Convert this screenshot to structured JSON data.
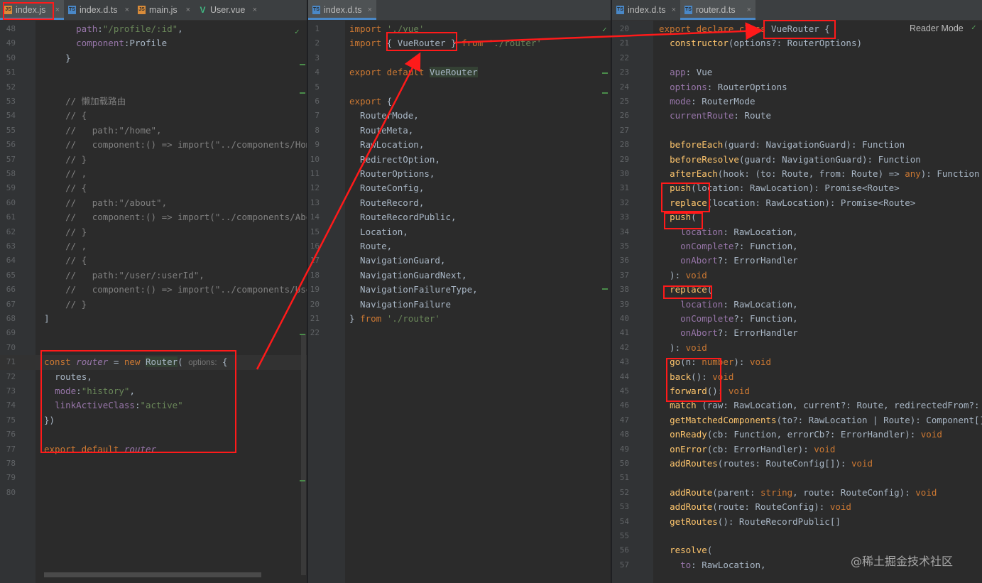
{
  "pane1": {
    "tabs": [
      {
        "label": "index.js",
        "icon": "js-file-icon",
        "active": true
      },
      {
        "label": "index.d.ts",
        "icon": "ts-file-icon",
        "active": false
      },
      {
        "label": "main.js",
        "icon": "js-file-icon",
        "active": false
      },
      {
        "label": "User.vue",
        "icon": "vue-file-icon",
        "active": false
      }
    ],
    "lines": [
      {
        "n": "48",
        "html": "      <span class='prop'>path</span>:<span class='str'>\"/profile/:id\"</span>,"
      },
      {
        "n": "49",
        "html": "      <span class='prop'>component</span>:Profile"
      },
      {
        "n": "50",
        "html": "    }"
      },
      {
        "n": "51",
        "html": ""
      },
      {
        "n": "52",
        "html": ""
      },
      {
        "n": "53",
        "html": "    <span class='com'>// 懒加载路由</span>"
      },
      {
        "n": "54",
        "html": "    <span class='com'>// {</span>"
      },
      {
        "n": "55",
        "html": "    <span class='com'>//   path:\"/home\",</span>"
      },
      {
        "n": "56",
        "html": "    <span class='com'>//   component:() =&gt; import(\"../components/Home\"</span>"
      },
      {
        "n": "57",
        "html": "    <span class='com'>// }</span>"
      },
      {
        "n": "58",
        "html": "    <span class='com'>// ,</span>"
      },
      {
        "n": "59",
        "html": "    <span class='com'>// {</span>"
      },
      {
        "n": "60",
        "html": "    <span class='com'>//   path:\"/about\",</span>"
      },
      {
        "n": "61",
        "html": "    <span class='com'>//   component:() =&gt; import(\"../components/About</span>"
      },
      {
        "n": "62",
        "html": "    <span class='com'>// }</span>"
      },
      {
        "n": "63",
        "html": "    <span class='com'>// ,</span>"
      },
      {
        "n": "64",
        "html": "    <span class='com'>// {</span>"
      },
      {
        "n": "65",
        "html": "    <span class='com'>//   path:\"/user/:userId\",</span>"
      },
      {
        "n": "66",
        "html": "    <span class='com'>//   component:() =&gt; import(\"../components/User\"</span>"
      },
      {
        "n": "67",
        "html": "    <span class='com'>// }</span>"
      },
      {
        "n": "68",
        "html": "]"
      },
      {
        "n": "69",
        "html": ""
      },
      {
        "n": "70",
        "html": ""
      },
      {
        "n": "71",
        "html": "<span class='kw'>const</span> <span class='ital'>router</span> = <span class='kw'>new</span> <span class='fn' style='color:#a9b7c6;background:#344134'>Router</span>( <span class='hint'>options:</span> {"
      },
      {
        "n": "72",
        "html": "  <span class='prop' style='color:#a9b7c6'>routes</span>,"
      },
      {
        "n": "73",
        "html": "  <span class='prop'>mode</span>:<span class='str'>\"history\"</span>,"
      },
      {
        "n": "74",
        "html": "  <span class='prop'>linkActiveClass</span>:<span class='str'>\"active\"</span>"
      },
      {
        "n": "75",
        "html": "})"
      },
      {
        "n": "76",
        "html": ""
      },
      {
        "n": "77",
        "html": "<span class='kw'>export default</span> <span class='ital'>router</span>"
      },
      {
        "n": "78",
        "html": ""
      },
      {
        "n": "79",
        "html": ""
      },
      {
        "n": "80",
        "html": ""
      }
    ]
  },
  "pane2": {
    "tabs": [
      {
        "label": "index.d.ts",
        "icon": "ts-file-icon",
        "active": true
      }
    ],
    "lines": [
      {
        "n": "1",
        "html": "<span class='kw'>import</span> <span class='str'>'./vue'</span>"
      },
      {
        "n": "2",
        "html": "<span class='kw'>import</span> { VueRouter } <span class='kw'>from</span> <span class='str'>'./router'</span>"
      },
      {
        "n": "3",
        "html": ""
      },
      {
        "n": "4",
        "html": "<span class='kw'>export default</span> <span style='background:#344134'>VueRouter</span>"
      },
      {
        "n": "5",
        "html": ""
      },
      {
        "n": "6",
        "html": "<span class='kw'>export</span> {"
      },
      {
        "n": "7",
        "html": "  RouterMode,"
      },
      {
        "n": "8",
        "html": "  RouteMeta,"
      },
      {
        "n": "9",
        "html": "  RawLocation,"
      },
      {
        "n": "10",
        "html": "  RedirectOption,"
      },
      {
        "n": "11",
        "html": "  RouterOptions,"
      },
      {
        "n": "12",
        "html": "  RouteConfig,"
      },
      {
        "n": "13",
        "html": "  RouteRecord,"
      },
      {
        "n": "14",
        "html": "  RouteRecordPublic,"
      },
      {
        "n": "15",
        "html": "  Location,"
      },
      {
        "n": "16",
        "html": "  Route,"
      },
      {
        "n": "17",
        "html": "  NavigationGuard,"
      },
      {
        "n": "18",
        "html": "  NavigationGuardNext,"
      },
      {
        "n": "19",
        "html": "  NavigationFailureType,"
      },
      {
        "n": "20",
        "html": "  NavigationFailure"
      },
      {
        "n": "21",
        "html": "} <span class='kw'>from</span> <span class='str'>'./router'</span>"
      },
      {
        "n": "22",
        "html": ""
      }
    ]
  },
  "pane3": {
    "tabs": [
      {
        "label": "index.d.ts",
        "icon": "ts-file-icon",
        "active": false
      },
      {
        "label": "router.d.ts",
        "icon": "ts-file-icon",
        "active": true
      }
    ],
    "reader_mode": "Reader Mode",
    "lines": [
      {
        "n": "20",
        "html": "<span class='kw'>export declare class</span> VueRouter {"
      },
      {
        "n": "21",
        "html": "  <span class='fn'>constructor</span>(options?: RouterOptions)"
      },
      {
        "n": "22",
        "html": ""
      },
      {
        "n": "23",
        "html": "  <span class='prop'>app</span>: Vue"
      },
      {
        "n": "24",
        "html": "  <span class='prop'>options</span>: RouterOptions"
      },
      {
        "n": "25",
        "html": "  <span class='prop'>mode</span>: RouterMode"
      },
      {
        "n": "26",
        "html": "  <span class='prop'>currentRoute</span>: Route"
      },
      {
        "n": "27",
        "html": ""
      },
      {
        "n": "28",
        "html": "  <span class='fn'>beforeEach</span>(guard: NavigationGuard): Function"
      },
      {
        "n": "29",
        "html": "  <span class='fn'>beforeResolve</span>(guard: NavigationGuard): Function"
      },
      {
        "n": "30",
        "html": "  <span class='fn'>afterEach</span>(hook: (to: Route, from: Route) =&gt; <span class='kw'>any</span>): Function"
      },
      {
        "n": "31",
        "html": "  <span class='fn'>push</span>(location: RawLocation): Promise&lt;Route&gt;"
      },
      {
        "n": "32",
        "html": "  <span class='fn'>replace</span>(location: RawLocation): Promise&lt;Route&gt;"
      },
      {
        "n": "33",
        "html": "  <span class='fn'>push</span>("
      },
      {
        "n": "34",
        "html": "    <span class='prop'>location</span>: RawLocation,"
      },
      {
        "n": "35",
        "html": "    <span class='prop'>onComplete</span>?: Function,"
      },
      {
        "n": "36",
        "html": "    <span class='prop'>onAbort</span>?: ErrorHandler"
      },
      {
        "n": "37",
        "html": "  ): <span class='kw'>void</span>"
      },
      {
        "n": "38",
        "html": "  <span class='fn'>replace</span>("
      },
      {
        "n": "39",
        "html": "    <span class='prop'>location</span>: RawLocation,"
      },
      {
        "n": "40",
        "html": "    <span class='prop'>onComplete</span>?: Function,"
      },
      {
        "n": "41",
        "html": "    <span class='prop'>onAbort</span>?: ErrorHandler"
      },
      {
        "n": "42",
        "html": "  ): <span class='kw'>void</span>"
      },
      {
        "n": "43",
        "html": "  <span class='fn'>go</span>(n: <span class='kw'>number</span>): <span class='kw'>void</span>"
      },
      {
        "n": "44",
        "html": "  <span class='fn'>back</span>(): <span class='kw'>void</span>"
      },
      {
        "n": "45",
        "html": "  <span class='fn'>forward</span>(): <span class='kw'>void</span>"
      },
      {
        "n": "46",
        "html": "  <span class='fn'>match</span> (raw: RawLocation, current?: Route, redirectedFrom?: L"
      },
      {
        "n": "47",
        "html": "  <span class='fn'>getMatchedComponents</span>(to?: RawLocation | Route): Component[]"
      },
      {
        "n": "48",
        "html": "  <span class='fn'>onReady</span>(cb: Function, errorCb?: ErrorHandler): <span class='kw'>void</span>"
      },
      {
        "n": "49",
        "html": "  <span class='fn'>onError</span>(cb: ErrorHandler): <span class='kw'>void</span>"
      },
      {
        "n": "50",
        "html": "  <span class='fn'>addRoutes</span>(routes: RouteConfig[]): <span class='kw'>void</span>"
      },
      {
        "n": "51",
        "html": ""
      },
      {
        "n": "52",
        "html": "  <span class='fn'>addRoute</span>(parent: <span class='kw'>string</span>, route: RouteConfig): <span class='kw'>void</span>"
      },
      {
        "n": "53",
        "html": "  <span class='fn'>addRoute</span>(route: RouteConfig): <span class='kw'>void</span>"
      },
      {
        "n": "54",
        "html": "  <span class='fn'>getRoutes</span>(): RouteRecordPublic[]"
      },
      {
        "n": "55",
        "html": ""
      },
      {
        "n": "56",
        "html": "  <span class='fn'>resolve</span>("
      },
      {
        "n": "57",
        "html": "    <span class='prop'>to</span>: RawLocation,"
      }
    ]
  },
  "watermark": "@稀土掘金技术社区",
  "colors": {
    "annotation": "#ff1a1a",
    "background": "#2b2b2b",
    "tabbar": "#3c3f41",
    "active_tab_underline": "#4a88c7"
  }
}
